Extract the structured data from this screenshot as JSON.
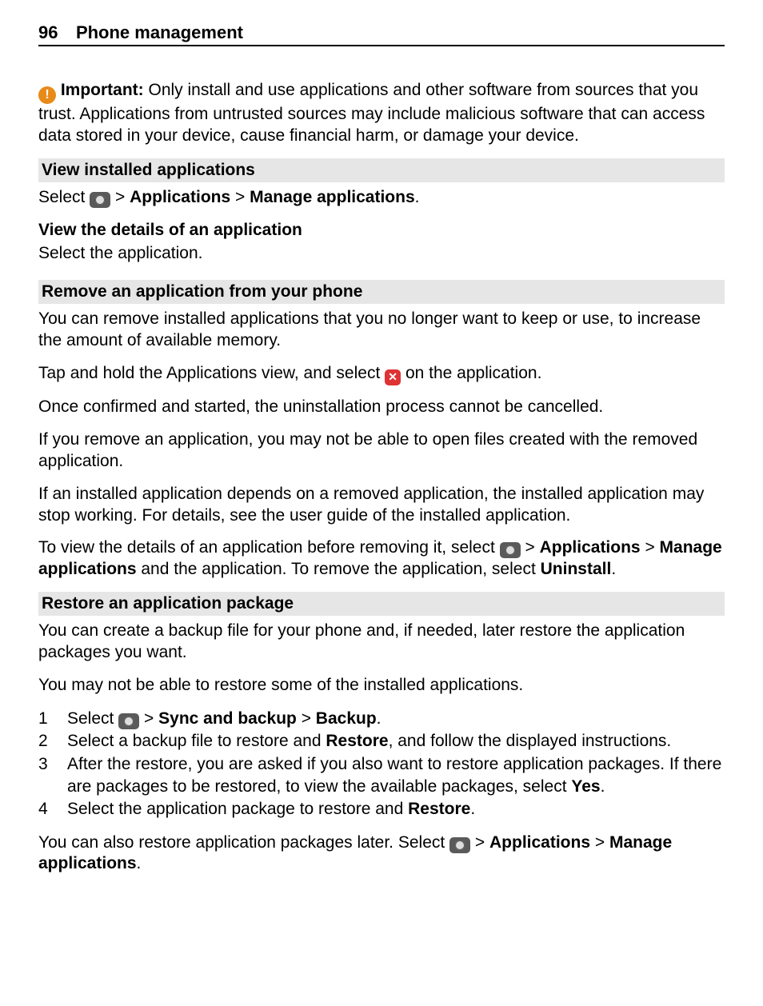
{
  "header": {
    "page_number": "96",
    "title": "Phone management"
  },
  "important": {
    "label": "Important:",
    "text": " Only install and use applications and other software from sources that you trust. Applications from untrusted sources may include malicious software that can access data stored in your device, cause financial harm, or damage your device."
  },
  "sec1": {
    "title": "View installed applications",
    "line1_a": "Select ",
    "line1_b": " > ",
    "line1_c": "Applications",
    "line1_d": " > ",
    "line1_e": "Manage applications",
    "line1_f": ".",
    "sub_title": "View the details of an application",
    "sub_text": "Select the application."
  },
  "sec2": {
    "title": "Remove an application from your phone",
    "p1": "You can remove installed applications that you no longer want to keep or use, to increase the amount of available memory.",
    "p2a": "Tap and hold the Applications view, and select ",
    "p2b": " on the application.",
    "p3": "Once confirmed and started, the uninstallation process cannot be cancelled.",
    "p4": "If you remove an application, you may not be able to open files created with the removed application.",
    "p5": "If an installed application depends on a removed application, the installed application may stop working. For details, see the user guide of the installed application.",
    "p6a": "To view the details of an application before removing it, select ",
    "p6b": " > ",
    "p6c": "Applications",
    "p6d": " > ",
    "p6e": "Manage applications",
    "p6f": " and the application. To remove the application, select ",
    "p6g": "Uninstall",
    "p6h": "."
  },
  "sec3": {
    "title": "Restore an application package",
    "p1": "You can create a backup file for your phone and, if needed, later restore the application packages you want.",
    "p2": "You may not be able to restore some of the installed applications.",
    "steps": {
      "n1": "1",
      "s1a": "Select ",
      "s1b": " > ",
      "s1c": "Sync and backup",
      "s1d": " > ",
      "s1e": "Backup",
      "s1f": ".",
      "n2": "2",
      "s2a": "Select a backup file to restore and ",
      "s2b": "Restore",
      "s2c": ", and follow the displayed instructions.",
      "n3": "3",
      "s3a": "After the restore, you are asked if you also want to restore application packages. If there are packages to be restored, to view the available packages, select ",
      "s3b": "Yes",
      "s3c": ".",
      "n4": "4",
      "s4a": "Select the application package to restore and ",
      "s4b": "Restore",
      "s4c": "."
    },
    "p3a": "You can also restore application packages later. Select ",
    "p3b": " > ",
    "p3c": "Applications",
    "p3d": " > ",
    "p3e": "Manage applications",
    "p3f": "."
  }
}
